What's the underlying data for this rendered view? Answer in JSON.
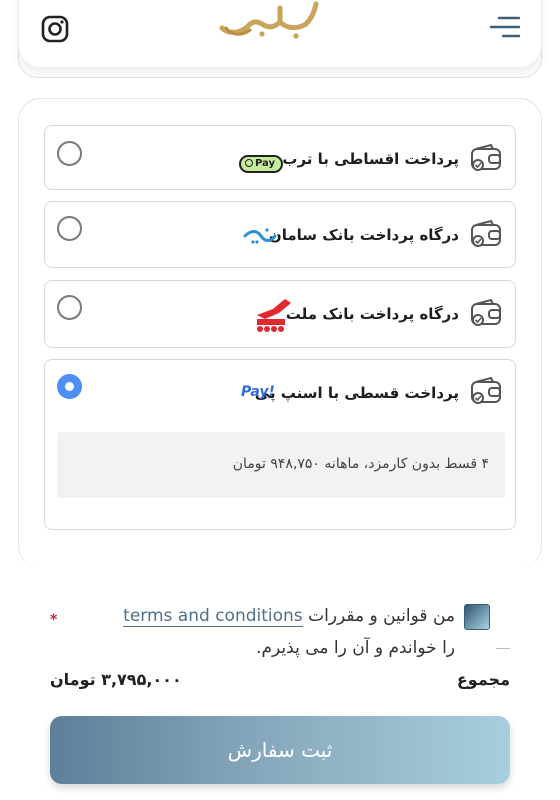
{
  "header": {
    "logo_icon": "calligraphy-logo",
    "instagram_icon": "instagram-icon",
    "menu_icon": "menu-icon"
  },
  "payment_options": [
    {
      "label": "پرداخت اقساطی با ترب پی",
      "brand": "Pay",
      "selected": false
    },
    {
      "label": "درگاه پرداخت بانک سامان",
      "brand": "saman-logo",
      "selected": false
    },
    {
      "label": "درگاه پرداخت بانک ملت",
      "brand": "mellat-logo",
      "selected": false
    },
    {
      "label": "پرداخت قسطی با اسنپ پی",
      "brand": "Pay!",
      "selected": true,
      "detail": "۴ قسط بدون کارمزد، ماهانه ۹۴۸,۷۵۰ تومان"
    }
  ],
  "terms": {
    "prefix": "من قوانین و مقررات",
    "link": "terms and conditions",
    "suffix": "را خواندم و آن را می پذیرم.",
    "required_mark": "*"
  },
  "summary": {
    "label": "مجموع",
    "value": "۳,۷۹۵,۰۰۰ تومان"
  },
  "submit_label": "ثبت سفارش",
  "colors": {
    "accent": "#4e8ff5",
    "gold": "#c9a45a",
    "button_start": "#5d7f98",
    "button_end": "#a7cfde"
  }
}
